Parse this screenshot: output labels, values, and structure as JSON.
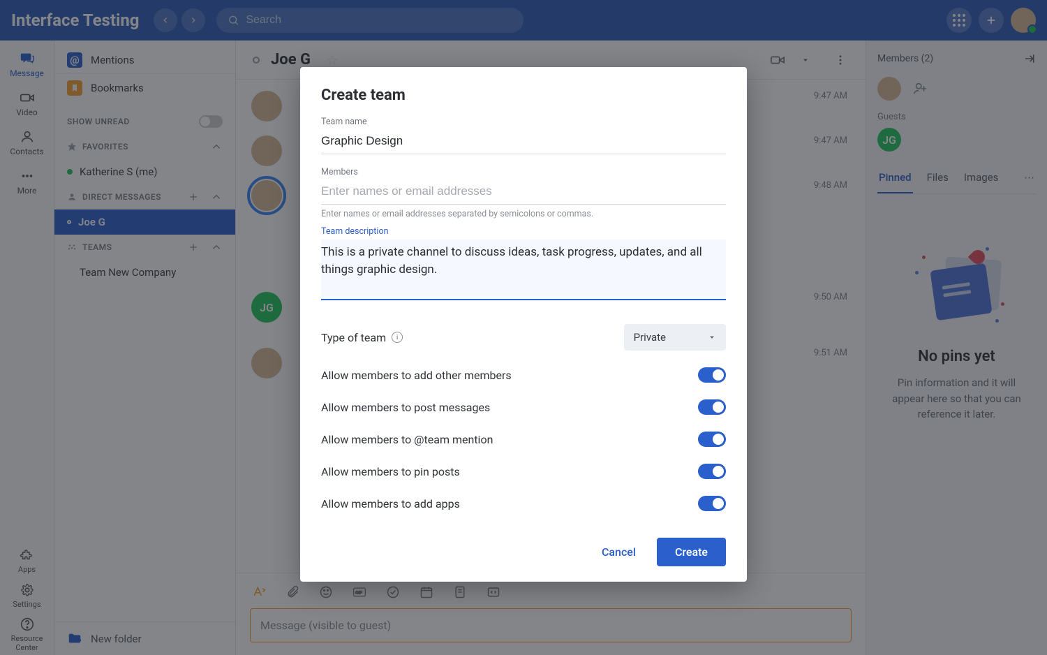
{
  "topbar": {
    "brand": "Interface Testing",
    "search_placeholder": "Search"
  },
  "rail": {
    "message": "Message",
    "video": "Video",
    "contacts": "Contacts",
    "more": "More",
    "apps": "Apps",
    "settings": "Settings",
    "resource_center_l1": "Resource",
    "resource_center_l2": "Center"
  },
  "sidebar": {
    "mentions": "Mentions",
    "bookmarks": "Bookmarks",
    "show_unread": "SHOW UNREAD",
    "favorites": "FAVORITES",
    "me_entry": "Katherine S (me)",
    "direct_messages": "DIRECT MESSAGES",
    "dm_entry": "Joe G",
    "teams": "TEAMS",
    "team_entry": "Team New Company",
    "new_folder": "New folder"
  },
  "chat": {
    "title": "Joe G",
    "times": [
      "9:47 AM",
      "9:47 AM",
      "9:48 AM",
      "9:50 AM",
      "9:51 AM"
    ],
    "jg_initials": "JG",
    "message_placeholder": "Message (visible to guest)"
  },
  "rightpanel": {
    "members_label": "Members (2)",
    "guests": "Guests",
    "jg_initials": "JG",
    "tabs": {
      "pinned": "Pinned",
      "files": "Files",
      "images": "Images"
    },
    "empty_title": "No pins yet",
    "empty_body": "Pin information and it will appear here so that you can reference it later."
  },
  "modal": {
    "title": "Create team",
    "team_name_label": "Team name",
    "team_name_value": "Graphic Design",
    "members_label": "Members",
    "members_placeholder": "Enter names or email addresses",
    "members_hint": "Enter names or email addresses separated by semicolons or commas.",
    "desc_label": "Team description",
    "desc_value": "This is a private channel to discuss ideas, task progress, updates, and all things graphic design.",
    "type_label": "Type of team",
    "type_value": "Private",
    "opt_add_members": "Allow members to add other members",
    "opt_post": "Allow members to post messages",
    "opt_mention": "Allow members to @team mention",
    "opt_pin": "Allow members to pin posts",
    "opt_apps": "Allow members to add apps",
    "cancel": "Cancel",
    "create": "Create"
  }
}
